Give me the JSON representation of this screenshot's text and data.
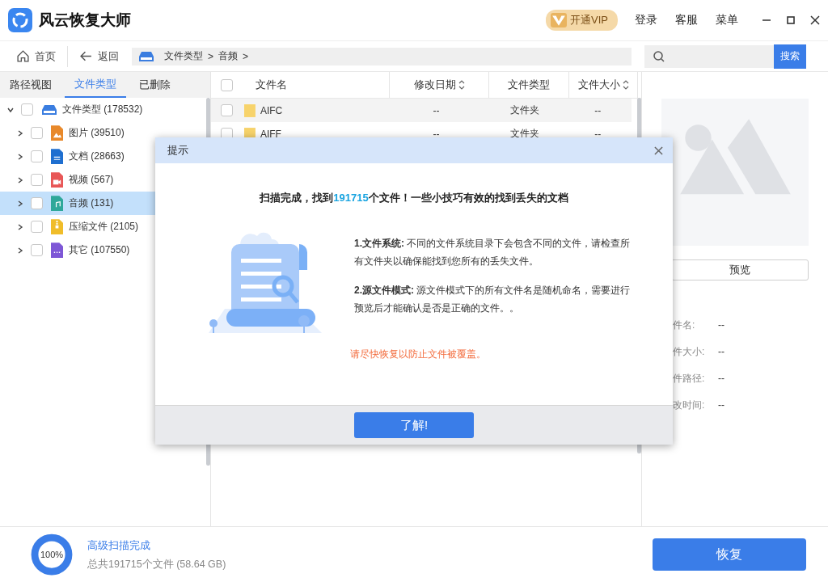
{
  "app": {
    "title": "风云恢复大师",
    "vip": "开通VIP",
    "menu": [
      "登录",
      "客服",
      "菜单"
    ]
  },
  "nav": {
    "home": "首页",
    "back": "返回",
    "breadcrumb": [
      "文件类型",
      ">",
      "音频",
      ">"
    ],
    "search_button": "搜索"
  },
  "sidebar": {
    "tabs": [
      {
        "label": "路径视图",
        "selected": false
      },
      {
        "label": "文件类型",
        "selected": true
      },
      {
        "label": "已删除",
        "selected": false
      }
    ],
    "tree": [
      {
        "label": "文件类型 (178532)",
        "kind": "drive",
        "expanded": true,
        "checked": false,
        "selected": false,
        "children": [
          {
            "label": "图片 (39510)",
            "kind": "image",
            "expanded": false,
            "checked": false,
            "selected": false
          },
          {
            "label": "文档 (28663)",
            "kind": "document",
            "expanded": false,
            "checked": false,
            "selected": false
          },
          {
            "label": "视频 (567)",
            "kind": "video",
            "expanded": false,
            "checked": false,
            "selected": false
          },
          {
            "label": "音频 (131)",
            "kind": "audio",
            "expanded": false,
            "checked": false,
            "selected": true
          },
          {
            "label": "压缩文件 (2105)",
            "kind": "archive",
            "expanded": false,
            "checked": false,
            "selected": false
          },
          {
            "label": "其它 (107550)",
            "kind": "other",
            "expanded": false,
            "checked": false,
            "selected": false
          }
        ]
      }
    ]
  },
  "table": {
    "all_checked": false,
    "columns": [
      "文件名",
      "修改日期",
      "文件类型",
      "文件大小"
    ],
    "rows": [
      {
        "name": "AIFC",
        "date": "--",
        "type": "文件夹",
        "size": "--",
        "checked": false,
        "selected": true
      },
      {
        "name": "AIFF",
        "date": "--",
        "type": "文件夹",
        "size": "--",
        "checked": false,
        "selected": false
      }
    ]
  },
  "preview": {
    "button": "预览",
    "fields": [
      {
        "label": "件名:",
        "value": "--"
      },
      {
        "label": "件大小:",
        "value": "--"
      },
      {
        "label": "件路径:",
        "value": "--"
      },
      {
        "label": "改时间:",
        "value": "--"
      }
    ]
  },
  "dialog": {
    "title": "提示",
    "headline_before": "扫描完成，找到",
    "headline_count": "191715",
    "headline_after": "个文件！一些小技巧有效的找到丢失的文档",
    "tips": [
      "**1.文件系统:** 不同的文件系统目录下会包含不同的文件，请检查所有文件夹以确保能找到您所有的丢失文件。",
      "**2.源文件模式:** 源文件模式下的所有文件名是随机命名，需要进行预览后才能确认是否是正确的文件。。"
    ],
    "warning": "请尽快恢复以防止文件被覆盖。",
    "ok": "了解!"
  },
  "status": {
    "progress_label": "100%",
    "level": 1,
    "title": "高级扫描完成",
    "summary": "总共191715个文件 (58.64 GB)",
    "recover": "恢复"
  }
}
